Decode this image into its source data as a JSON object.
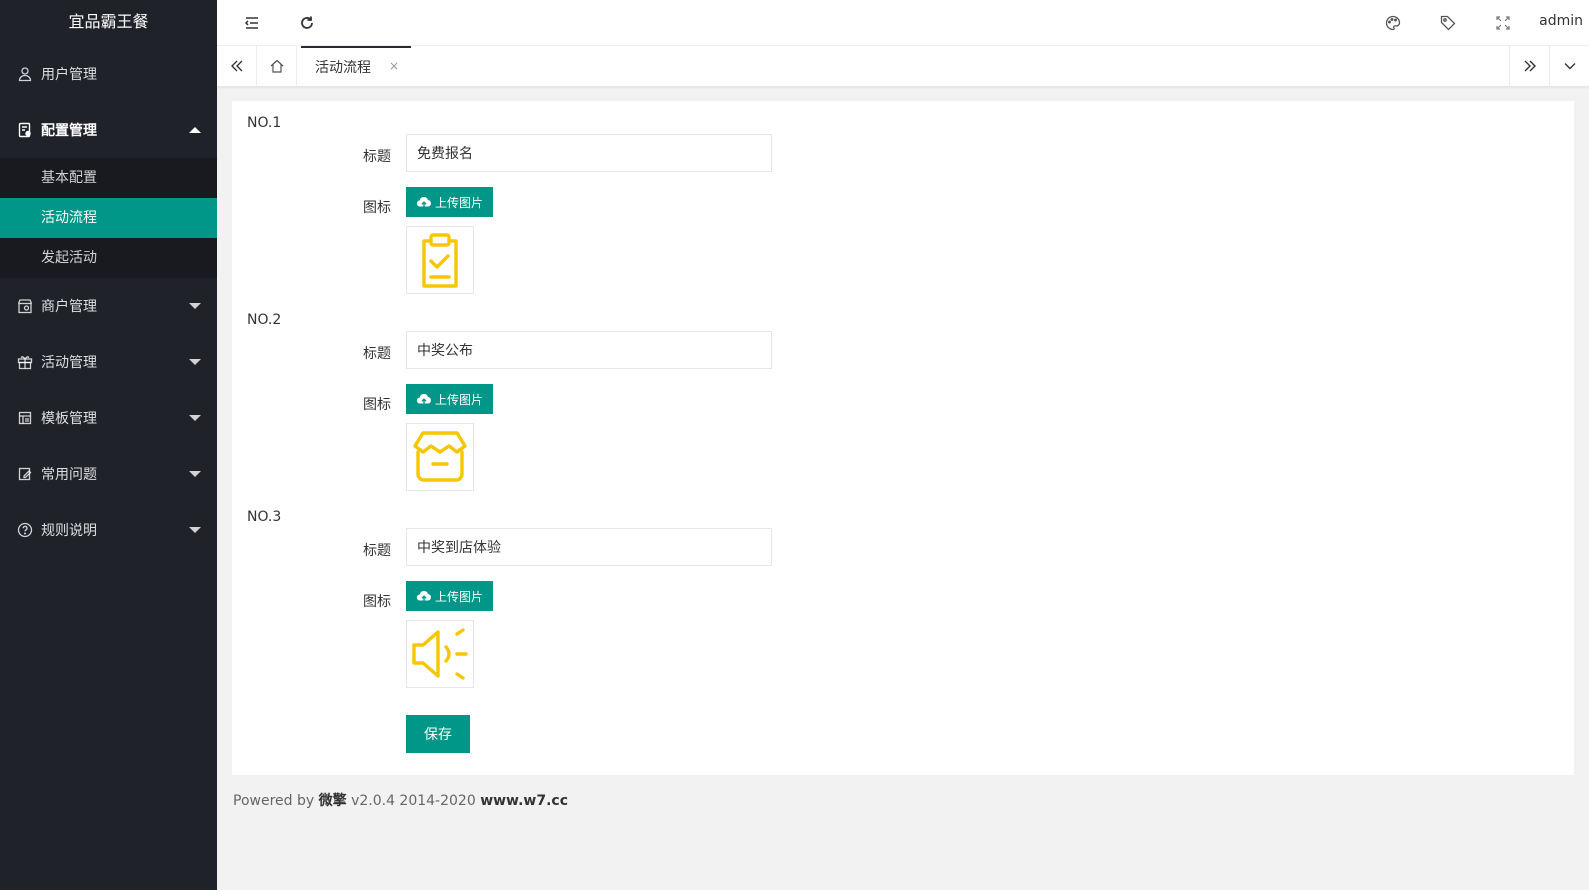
{
  "app": {
    "title": "宜品霸王餐"
  },
  "sidebar": {
    "items": [
      {
        "label": "用户管理",
        "icon": "user-icon"
      },
      {
        "label": "配置管理",
        "icon": "document-settings-icon",
        "open": true,
        "children": [
          {
            "label": "基本配置"
          },
          {
            "label": "活动流程",
            "active": true
          },
          {
            "label": "发起活动"
          }
        ]
      },
      {
        "label": "商户管理",
        "icon": "store-icon"
      },
      {
        "label": "活动管理",
        "icon": "gift-icon"
      },
      {
        "label": "模板管理",
        "icon": "template-icon"
      },
      {
        "label": "常用问题",
        "icon": "edit-icon"
      },
      {
        "label": "规则说明",
        "icon": "help-icon"
      }
    ]
  },
  "header": {
    "user": "admin"
  },
  "tabs": {
    "active_label": "活动流程",
    "close": "×"
  },
  "form": {
    "title_label": "标题",
    "icon_label": "图标",
    "upload_label": "上传图片",
    "save_label": "保存",
    "steps": [
      {
        "no": "NO.1",
        "title": "免费报名",
        "icon": "clipboard-check-icon"
      },
      {
        "no": "NO.2",
        "title": "中奖公布",
        "icon": "shop-box-icon"
      },
      {
        "no": "NO.3",
        "title": "中奖到店体验",
        "icon": "megaphone-icon"
      }
    ]
  },
  "footer": {
    "prefix": "Powered by",
    "brand": "微擎",
    "version": "v2.0.4 2014-2020",
    "site": "www.w7.cc"
  },
  "colors": {
    "accent": "#009688",
    "sidebar": "#20222a",
    "icon_yellow": "#f7c600"
  }
}
